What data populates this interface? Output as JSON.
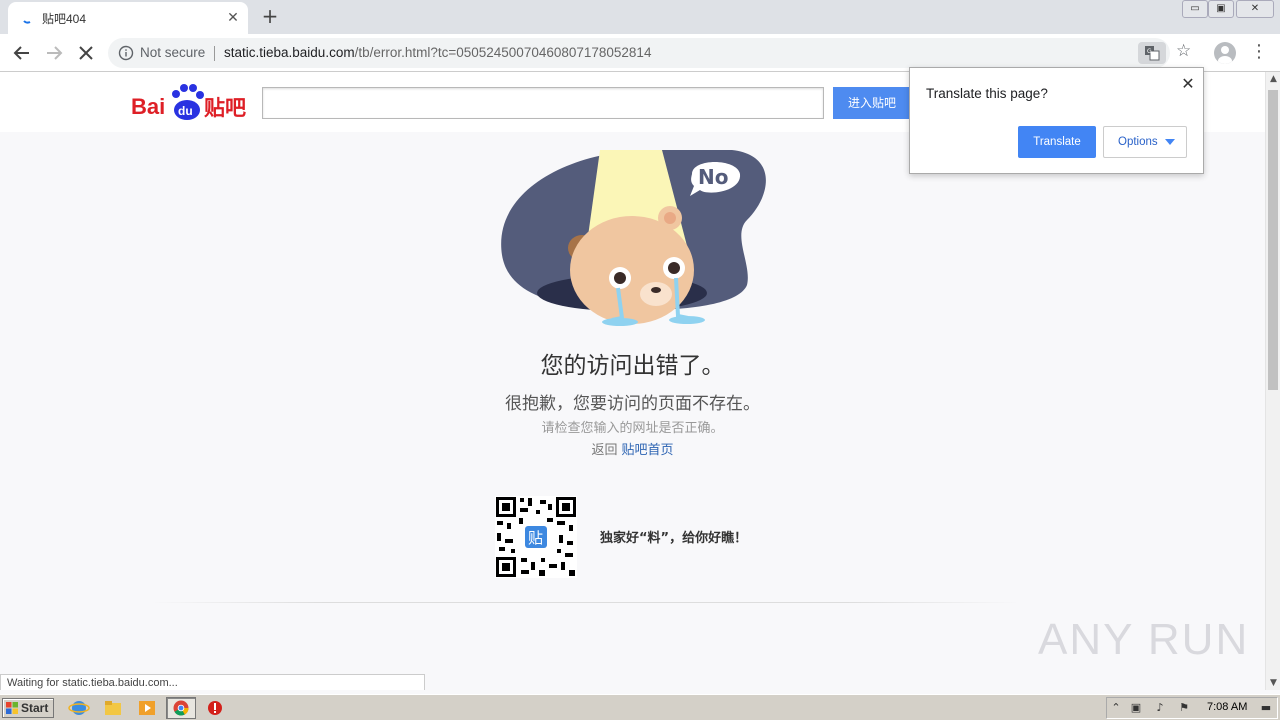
{
  "browser": {
    "tab_title": "贴吧404",
    "new_tab_label": "+",
    "tab_close_label": "✕",
    "window_controls": [
      "▭",
      "▣",
      "✕"
    ],
    "security_label": "Not secure",
    "url_host": "static.tieba.baidu.com",
    "url_path": "/tb/error.html?tc=05052450070460807178052814",
    "status_text": "Waiting for static.tieba.baidu.com..."
  },
  "translate_popup": {
    "title": "Translate this page?",
    "translate_label": "Translate",
    "options_label": "Options",
    "close_label": "✕"
  },
  "site": {
    "logo_text_latin": "Bai",
    "logo_text_du": "du",
    "logo_text_cn": "贴吧",
    "search_value": "",
    "search_button_label": "进入贴吧"
  },
  "error": {
    "bubble_text": "No",
    "title": "您的访问出错了。",
    "subtitle": "很抱歉，您要访问的页面不存在。",
    "hint": "请检查您输入的网址是否正确。",
    "back_prefix": "返回",
    "back_link": "贴吧首页",
    "qr_badge": "贴",
    "qr_caption": "独家好“料”，给你好瞧！"
  },
  "watermark": "ANY RUN",
  "taskbar": {
    "start_label": "Start",
    "clock": "7:08 AM"
  },
  "colors": {
    "baidu_red": "#de1f26",
    "baidu_blue": "#2932e1",
    "link_blue": "#2d64b3",
    "button_blue": "#4285f4"
  }
}
